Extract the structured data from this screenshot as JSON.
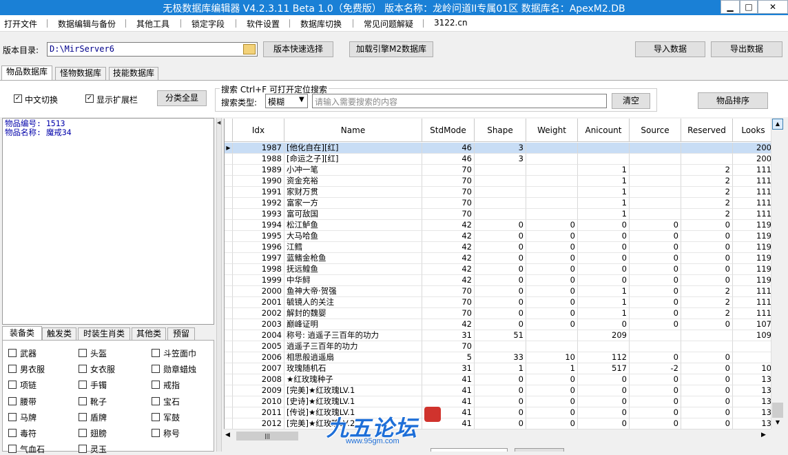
{
  "window": {
    "title": "无极数据库编辑器 V4.2.3.11    Beta 1.0（免费版）    版本名称：龙岭问道II专属01区    数据库名：ApexM2.DB",
    "minimize": "▁",
    "maximize": "□",
    "close": "✕"
  },
  "menu": [
    "打开文件",
    "数据编辑与备份",
    "其他工具",
    "锁定字段",
    "软件设置",
    "数据库切换",
    "常见问题解疑",
    "3122.cn"
  ],
  "toolbar": {
    "dir_label": "版本目录:",
    "dir_value": "D:\\MirServer6",
    "quick_select": "版本快速选择",
    "load_engine": "加载引擎M2数据库",
    "import": "导入数据",
    "export": "导出数据"
  },
  "tabs": [
    "物品数据库",
    "怪物数据库",
    "技能数据库"
  ],
  "options": {
    "chinese_switch": "中文切换",
    "show_ext": "显示扩展栏",
    "show_all": "分类全显",
    "check": "✓"
  },
  "search": {
    "title": "搜索  Ctrl+F 可打开定位搜索",
    "type_label": "搜索类型:",
    "type_value": "模糊",
    "placeholder": "请输入需要搜索的内容",
    "clear": "清空",
    "sort": "物品排序"
  },
  "info": {
    "line1": "物品编号: 1513",
    "line2": "物品名称: 魔戒34"
  },
  "cat_tabs": [
    "装备类",
    "触发类",
    "时装生肖类",
    "其他类",
    "预留"
  ],
  "categories": [
    "武器",
    "头盔",
    "斗笠面巾",
    "男衣服",
    "女衣服",
    "勋章蜡烛",
    "项链",
    "手镯",
    "戒指",
    "腰带",
    "靴子",
    "宝石",
    "马牌",
    "盾牌",
    "军鼓",
    "毒符",
    "翅膀",
    "称号",
    "气血石",
    "灵玉"
  ],
  "grid": {
    "columns": [
      "Idx",
      "Name",
      "StdMode",
      "Shape",
      "Weight",
      "Anicount",
      "Source",
      "Reserved",
      "Looks"
    ],
    "rows": [
      [
        "1987",
        "[他化自在][红]",
        "46",
        "3",
        "",
        "",
        "",
        "",
        "200"
      ],
      [
        "1988",
        "[命运之子][红]",
        "46",
        "3",
        "",
        "",
        "",
        "",
        "200"
      ],
      [
        "1989",
        "小冲一笔",
        "70",
        "",
        "",
        "1",
        "",
        "2",
        "111"
      ],
      [
        "1990",
        "资金充裕",
        "70",
        "",
        "",
        "1",
        "",
        "2",
        "111"
      ],
      [
        "1991",
        "家财万贯",
        "70",
        "",
        "",
        "1",
        "",
        "2",
        "111"
      ],
      [
        "1992",
        "富家一方",
        "70",
        "",
        "",
        "1",
        "",
        "2",
        "111"
      ],
      [
        "1993",
        "富可敌国",
        "70",
        "",
        "",
        "1",
        "",
        "2",
        "111"
      ],
      [
        "1994",
        "松江鲈鱼",
        "42",
        "0",
        "0",
        "0",
        "0",
        "0",
        "119"
      ],
      [
        "1995",
        "大马哈鱼",
        "42",
        "0",
        "0",
        "0",
        "0",
        "0",
        "119"
      ],
      [
        "1996",
        "江鳕",
        "42",
        "0",
        "0",
        "0",
        "0",
        "0",
        "119"
      ],
      [
        "1997",
        "蓝鳍金枪鱼",
        "42",
        "0",
        "0",
        "0",
        "0",
        "0",
        "119"
      ],
      [
        "1998",
        "抚远鳇鱼",
        "42",
        "0",
        "0",
        "0",
        "0",
        "0",
        "119"
      ],
      [
        "1999",
        "中华鲟",
        "42",
        "0",
        "0",
        "0",
        "0",
        "0",
        "119"
      ],
      [
        "2000",
        "鱼神大帝·贺强",
        "70",
        "0",
        "0",
        "1",
        "0",
        "2",
        "111"
      ],
      [
        "2001",
        "毓镜人的关注",
        "70",
        "0",
        "0",
        "1",
        "0",
        "2",
        "111"
      ],
      [
        "2002",
        "解封的魏婴",
        "70",
        "0",
        "0",
        "1",
        "0",
        "2",
        "111"
      ],
      [
        "2003",
        "巅峰证明",
        "42",
        "0",
        "0",
        "0",
        "0",
        "0",
        "107"
      ],
      [
        "2004",
        "称号: 逍遥子三百年的功力",
        "31",
        "51",
        "",
        "209",
        "",
        "",
        "109"
      ],
      [
        "2005",
        "逍遥子三百年的功力",
        "70",
        "",
        "",
        "",
        "",
        "",
        ""
      ],
      [
        "2006",
        "相思般逍遥扇",
        "5",
        "33",
        "10",
        "112",
        "0",
        "0",
        ""
      ],
      [
        "2007",
        "玫瑰随机石",
        "31",
        "1",
        "1",
        "517",
        "-2",
        "0",
        "10"
      ],
      [
        "2008",
        "★红玫瑰种子",
        "41",
        "0",
        "0",
        "0",
        "0",
        "0",
        "13"
      ],
      [
        "2009",
        "[完美]★红玫瑰LV.1",
        "41",
        "0",
        "0",
        "0",
        "0",
        "0",
        "13"
      ],
      [
        "2010",
        "[史诗]★红玫瑰LV.1",
        "41",
        "0",
        "0",
        "0",
        "0",
        "0",
        "13"
      ],
      [
        "2011",
        "[传说]★红玫瑰LV.1",
        "41",
        "0",
        "0",
        "0",
        "0",
        "0",
        "13"
      ],
      [
        "2012",
        "[完美]★红玫瑰LV.2",
        "41",
        "0",
        "0",
        "0",
        "0",
        "0",
        "13"
      ]
    ],
    "scroll_h": "|||"
  },
  "watermark": {
    "logo": "九五论坛",
    "url": "www.95gm.com"
  },
  "colors": {
    "titlebar": "#1a80d6",
    "selected_row": "#c8ddf5",
    "info_text": "#0000aa"
  }
}
